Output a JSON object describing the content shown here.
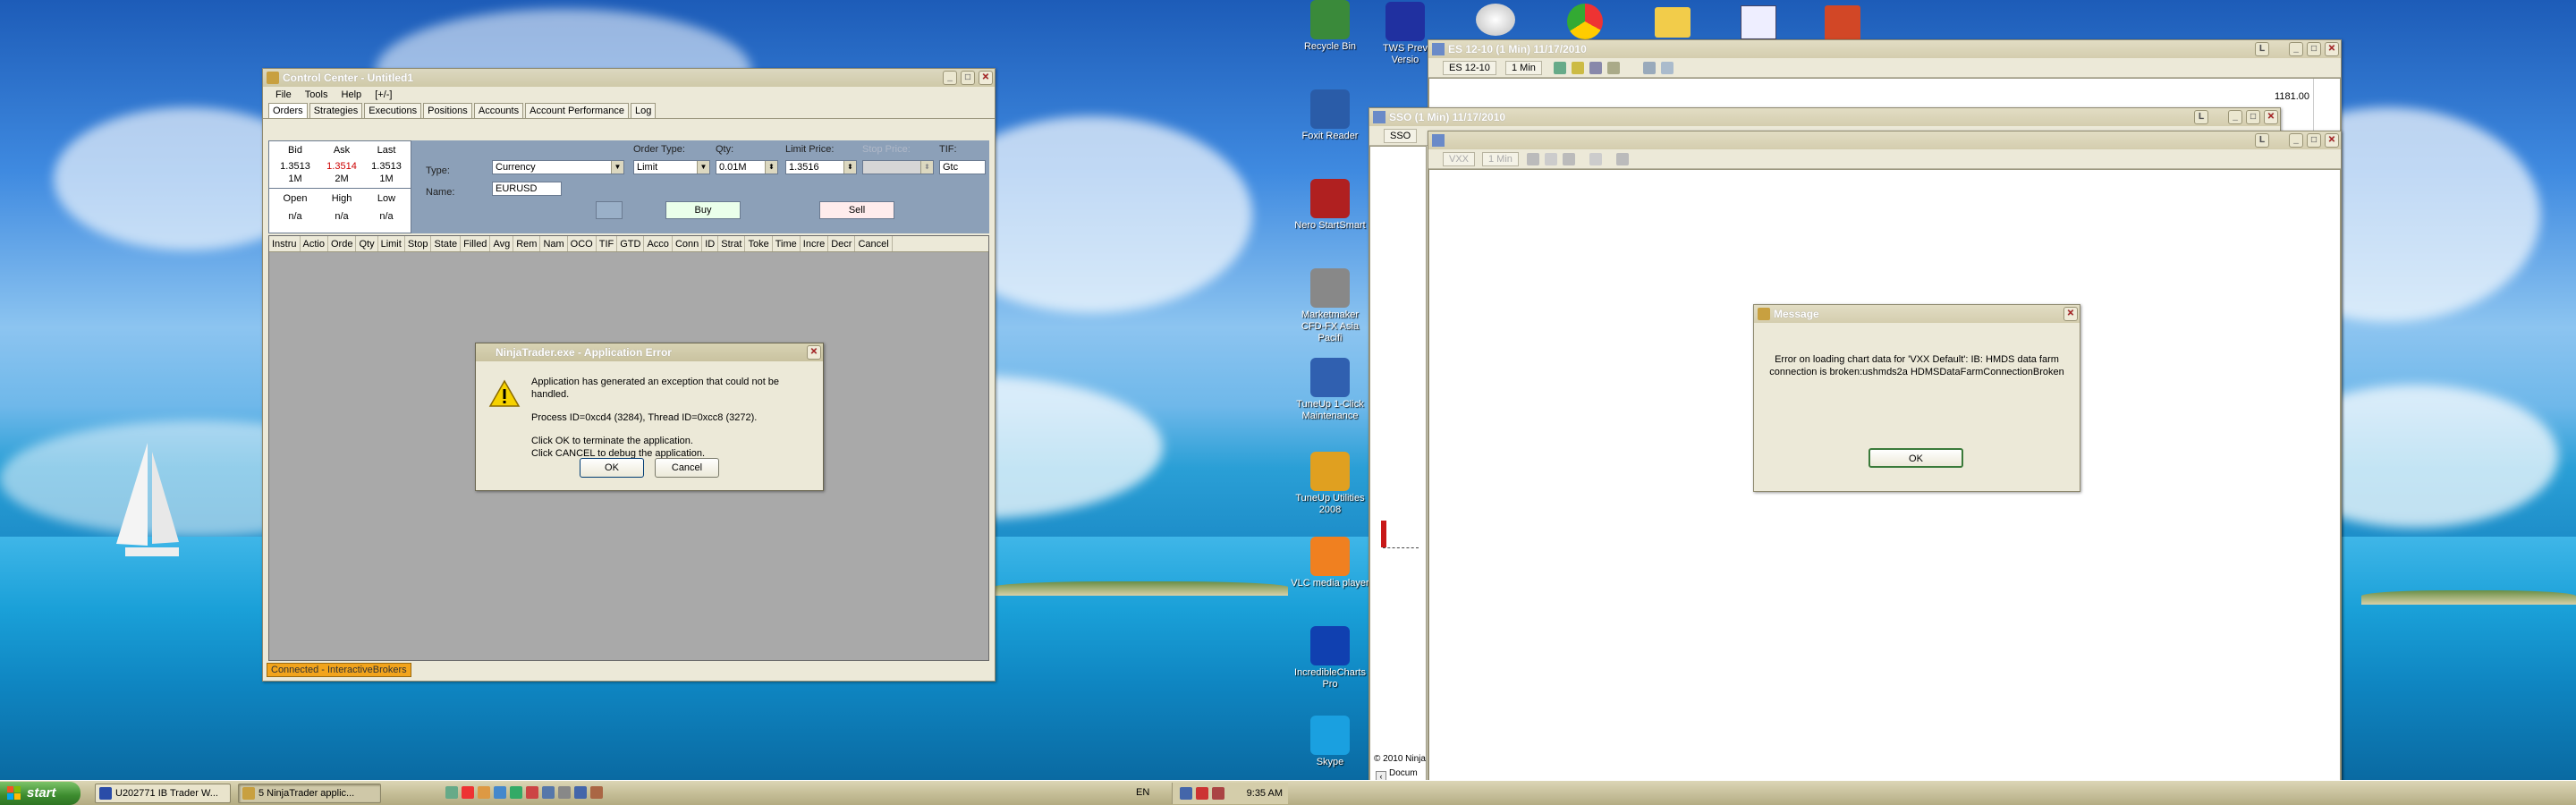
{
  "taskbar": {
    "start_label": "start",
    "tasks": [
      {
        "label": "U202771 IB Trader W..."
      },
      {
        "label": "5 NinjaTrader applic..."
      }
    ],
    "lang": "EN",
    "clock": "9:35 AM"
  },
  "control_center": {
    "title": "Control Center - Untitled1",
    "menu": [
      "File",
      "Tools",
      "Help",
      "[+/-]"
    ],
    "tabs": [
      "Orders",
      "Strategies",
      "Executions",
      "Positions",
      "Accounts",
      "Account Performance",
      "Log"
    ],
    "quote": {
      "headers": [
        "Bid",
        "Ask",
        "Last"
      ],
      "values": [
        "1.3513",
        "1.3514",
        "1.3513"
      ],
      "sizes": [
        "1M",
        "2M",
        "1M"
      ],
      "headers2": [
        "Open",
        "High",
        "Low"
      ],
      "values2": [
        "n/a",
        "n/a",
        "n/a"
      ]
    },
    "order": {
      "type_label": "Type:",
      "type_value": "Currency",
      "name_label": "Name:",
      "name_value": "EURUSD",
      "order_type_label": "Order Type:",
      "order_type_value": "Limit",
      "qty_label": "Qty:",
      "qty_value": "0.01M",
      "limit_label": "Limit Price:",
      "limit_value": "1.3516",
      "stop_label": "Stop Price:",
      "tif_label": "TIF:",
      "tif_value": "Gtc",
      "buy": "Buy",
      "sell": "Sell"
    },
    "columns": [
      "Instru",
      "Actio",
      "Orde",
      "Qty",
      "Limit",
      "Stop",
      "State",
      "Filled",
      "Avg",
      "Rem",
      "Nam",
      "OCO",
      "TIF",
      "GTD",
      "Acco",
      "Conn",
      "ID",
      "Strat",
      "Toke",
      "Time",
      "Incre",
      "Decr",
      "Cancel"
    ],
    "status": "Connected - InteractiveBrokers"
  },
  "app_error": {
    "title": "NinjaTrader.exe - Application Error",
    "line1": "Application has generated an exception that could not be handled.",
    "line2": "Process ID=0xcd4 (3284), Thread ID=0xcc8 (3272).",
    "line3": "Click OK to terminate the application.",
    "line4": "Click CANCEL to debug the application.",
    "ok": "OK",
    "cancel": "Cancel"
  },
  "desktop_icons": [
    {
      "label": "Recycle Bin",
      "color": "#3a8a3a"
    },
    {
      "label": "Foxit Reader",
      "color": "#2a5ca8"
    },
    {
      "label": "Nero StartSmart",
      "color": "#b02020"
    },
    {
      "label": "Marketmaker CFD-FX Asia Pacifi",
      "color": "#888"
    },
    {
      "label": "TuneUp 1-Click Maintenance",
      "color": "#3060b0"
    },
    {
      "label": "TuneUp Utilities 2008",
      "color": "#e0a020"
    },
    {
      "label": "VLC media player",
      "color": "#f08020"
    },
    {
      "label": "IncredibleCharts Pro",
      "color": "#1040b0"
    },
    {
      "label": "Skype",
      "color": "#1aa0e0"
    }
  ],
  "top_icons": [
    {
      "label": "TWS Prev Versio",
      "color": "#2030a0"
    }
  ],
  "chart_es": {
    "title": "ES 12-10 (1 Min)  11/17/2010",
    "instrument": "ES 12-10",
    "interval": "1 Min",
    "price": "1181.00"
  },
  "chart_sso": {
    "title": "SSO (1 Min)  11/17/2010",
    "instrument": "SSO",
    "copyright": "© 2010 Ninja",
    "docum": "Docum"
  },
  "chart_vxx": {
    "instrument": "VXX",
    "interval": "1 Min"
  },
  "message": {
    "title": "Message",
    "line1": "Error on loading chart data for 'VXX Default': IB: HMDS data farm",
    "line2": "connection is broken:ushmds2a HDMSDataFarmConnectionBroken",
    "ok": "OK"
  }
}
